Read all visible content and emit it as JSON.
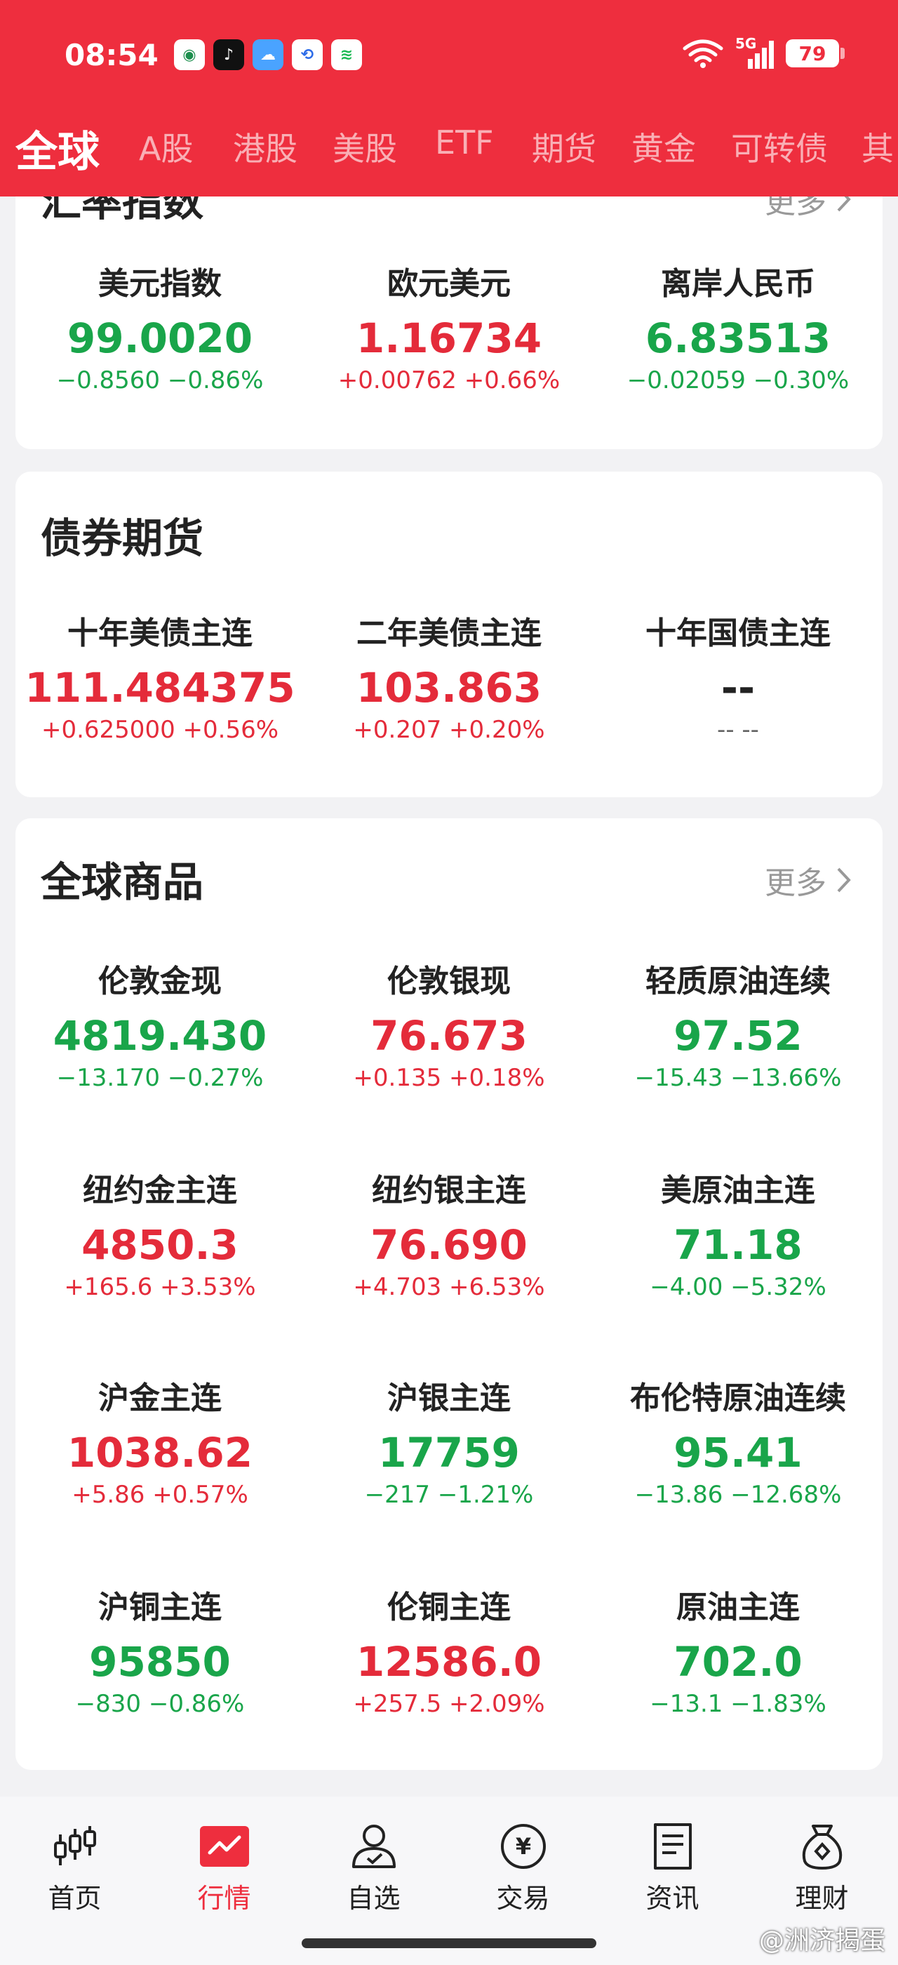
{
  "status_bar": {
    "time": "08:54",
    "network": "5G",
    "battery": "79"
  },
  "tabs": [
    "全球",
    "A股",
    "港股",
    "美股",
    "ETF",
    "期货",
    "黄金",
    "可转债",
    "其"
  ],
  "forex": {
    "title_partial": "汇率指数",
    "more": "更多",
    "items": [
      {
        "name": "美元指数",
        "price": "99.0020",
        "change": "−0.8560 −0.86%",
        "dir": "down"
      },
      {
        "name": "欧元美元",
        "price": "1.16734",
        "change": "+0.00762 +0.66%",
        "dir": "up"
      },
      {
        "name": "离岸人民币",
        "price": "6.83513",
        "change": "−0.02059 −0.30%",
        "dir": "down"
      }
    ]
  },
  "bonds": {
    "title": "债券期货",
    "items": [
      {
        "name": "十年美债主连",
        "price": "111.484375",
        "change": "+0.625000 +0.56%",
        "dir": "up"
      },
      {
        "name": "二年美债主连",
        "price": "103.863",
        "change": "+0.207 +0.20%",
        "dir": "up"
      },
      {
        "name": "十年国债主连",
        "price": "--",
        "change": "-- --",
        "dir": "flat"
      }
    ]
  },
  "commodities": {
    "title": "全球商品",
    "more": "更多",
    "items": [
      {
        "name": "伦敦金现",
        "price": "4819.430",
        "change": "−13.170 −0.27%",
        "dir": "down"
      },
      {
        "name": "伦敦银现",
        "price": "76.673",
        "change": "+0.135 +0.18%",
        "dir": "up"
      },
      {
        "name": "轻质原油连续",
        "price": "97.52",
        "change": "−15.43 −13.66%",
        "dir": "down"
      },
      {
        "name": "纽约金主连",
        "price": "4850.3",
        "change": "+165.6 +3.53%",
        "dir": "up"
      },
      {
        "name": "纽约银主连",
        "price": "76.690",
        "change": "+4.703 +6.53%",
        "dir": "up"
      },
      {
        "name": "美原油主连",
        "price": "71.18",
        "change": "−4.00 −5.32%",
        "dir": "down"
      },
      {
        "name": "沪金主连",
        "price": "1038.62",
        "change": "+5.86 +0.57%",
        "dir": "up"
      },
      {
        "name": "沪银主连",
        "price": "17759",
        "change": "−217 −1.21%",
        "dir": "down"
      },
      {
        "name": "布伦特原油连续",
        "price": "95.41",
        "change": "−13.86 −12.68%",
        "dir": "down"
      },
      {
        "name": "沪铜主连",
        "price": "95850",
        "change": "−830 −0.86%",
        "dir": "down"
      },
      {
        "name": "伦铜主连",
        "price": "12586.0",
        "change": "+257.5 +2.09%",
        "dir": "up"
      },
      {
        "name": "原油主连",
        "price": "702.0",
        "change": "−13.1 −1.83%",
        "dir": "down"
      }
    ]
  },
  "bottom_nav": [
    {
      "label": "首页",
      "icon": "candlestick-icon"
    },
    {
      "label": "行情",
      "icon": "market-chart-icon",
      "active": true
    },
    {
      "label": "自选",
      "icon": "user-check-icon"
    },
    {
      "label": "交易",
      "icon": "yen-coin-icon"
    },
    {
      "label": "资讯",
      "icon": "news-document-icon"
    },
    {
      "label": "理财",
      "icon": "money-bag-icon"
    }
  ],
  "watermark": "@洲济揭蛋",
  "colors": {
    "brand_red": "#ee2e3e",
    "up": "#e42b3a",
    "down": "#19a54a"
  }
}
